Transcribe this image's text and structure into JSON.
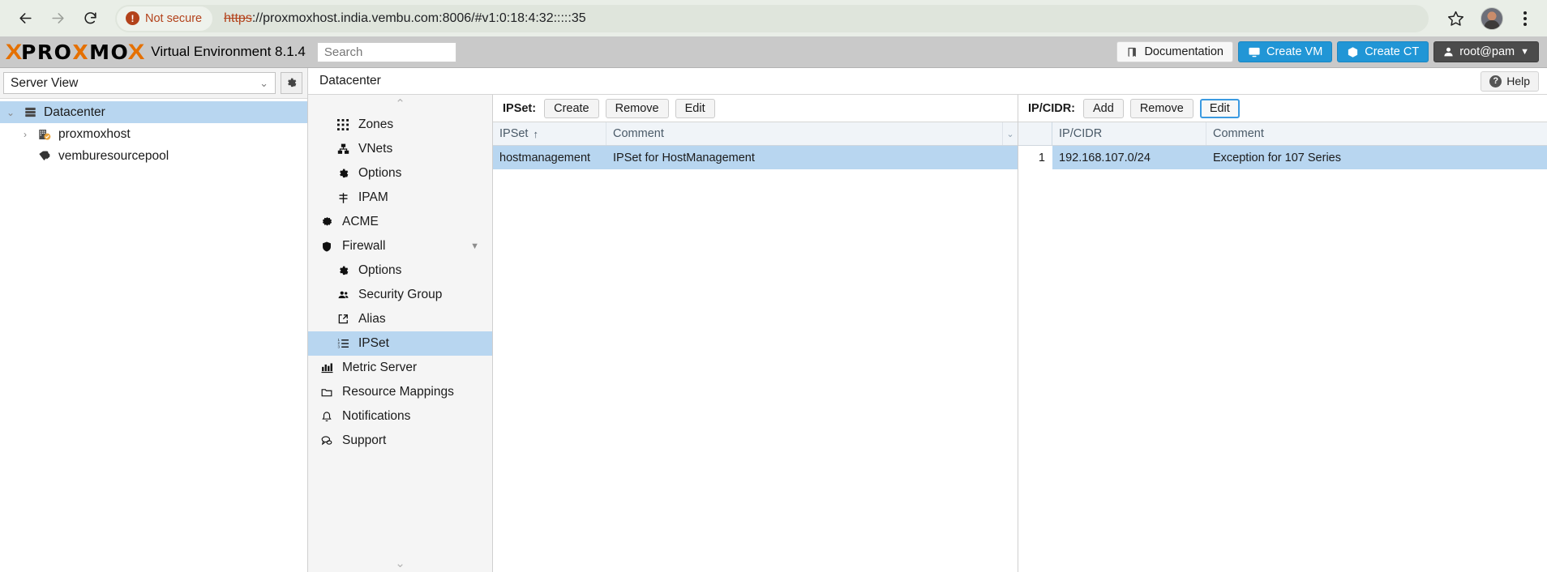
{
  "browser": {
    "back_icon": "back-arrow",
    "forward_icon": "forward-arrow",
    "reload_icon": "reload",
    "security_label": "Not secure",
    "url_scheme": "https",
    "url_rest": "://proxmoxhost.india.vembu.com:8006/#v1:0:18:4:32:::::35",
    "star_icon": "bookmark-star",
    "menu_icon": "three-dot-menu"
  },
  "header": {
    "logo_prefix": "PRO",
    "logo_x1": "X",
    "logo_mid": "MO",
    "logo_x2": "X",
    "product_title": "Virtual Environment 8.1.4",
    "search_placeholder": "Search",
    "search_value": "",
    "documentation_label": "Documentation",
    "create_vm_label": "Create VM",
    "create_ct_label": "Create CT",
    "user_label": "root@pam",
    "accent_blue": "#2196d6",
    "accent_orange": "#e57000"
  },
  "sidebar": {
    "view_selector_value": "Server View",
    "gear_icon": "gear-icon",
    "tree": [
      {
        "label": "Datacenter",
        "icon": "datacenter-icon",
        "selected": true,
        "twisty": "expanded",
        "level": 0
      },
      {
        "label": "proxmoxhost",
        "icon": "node-icon",
        "selected": false,
        "twisty": "collapsed",
        "level": 1
      },
      {
        "label": "vemburesourcepool",
        "icon": "pool-tag-icon",
        "selected": false,
        "twisty": "none",
        "level": 1
      }
    ]
  },
  "breadcrumb": {
    "title": "Datacenter",
    "help_label": "Help",
    "help_icon": "question-circle-icon"
  },
  "nav": {
    "scroll_up_icon": "chevron-up-icon",
    "scroll_down_icon": "chevron-down-icon",
    "items": [
      {
        "label": "Zones",
        "icon": "grid-icon",
        "level": 1,
        "selected": false
      },
      {
        "label": "VNets",
        "icon": "sitemap-icon",
        "level": 1,
        "selected": false
      },
      {
        "label": "Options",
        "icon": "gear-icon",
        "level": 1,
        "selected": false
      },
      {
        "label": "IPAM",
        "icon": "signpost-icon",
        "level": 1,
        "selected": false
      },
      {
        "label": "ACME",
        "icon": "certificate-icon",
        "level": 0,
        "selected": false
      },
      {
        "label": "Firewall",
        "icon": "shield-icon",
        "level": 0,
        "selected": false,
        "caret": true
      },
      {
        "label": "Options",
        "icon": "gear-icon",
        "level": 1,
        "selected": false
      },
      {
        "label": "Security Group",
        "icon": "users-icon",
        "level": 1,
        "selected": false
      },
      {
        "label": "Alias",
        "icon": "external-link-icon",
        "level": 1,
        "selected": false
      },
      {
        "label": "IPSet",
        "icon": "list-ol-icon",
        "level": 1,
        "selected": true
      },
      {
        "label": "Metric Server",
        "icon": "bar-chart-icon",
        "level": 0,
        "selected": false
      },
      {
        "label": "Resource Mappings",
        "icon": "folder-icon",
        "level": 0,
        "selected": false
      },
      {
        "label": "Notifications",
        "icon": "bell-icon",
        "level": 0,
        "selected": false
      },
      {
        "label": "Support",
        "icon": "comments-icon",
        "level": 0,
        "selected": false
      }
    ]
  },
  "ipset_panel": {
    "toolbar_label": "IPSet:",
    "buttons": [
      {
        "label": "Create",
        "focused": false
      },
      {
        "label": "Remove",
        "focused": false
      },
      {
        "label": "Edit",
        "focused": false
      }
    ],
    "columns": [
      {
        "label": "IPSet",
        "sort": "↑"
      },
      {
        "label": "Comment",
        "sort": ""
      }
    ],
    "column_menu_icon": "chevron-down-icon",
    "rows": [
      {
        "ipset": "hostmanagement",
        "comment": "IPSet for HostManagement",
        "selected": true
      }
    ]
  },
  "ipcidr_panel": {
    "toolbar_label": "IP/CIDR:",
    "buttons": [
      {
        "label": "Add",
        "focused": false
      },
      {
        "label": "Remove",
        "focused": false
      },
      {
        "label": "Edit",
        "focused": true
      }
    ],
    "columns": [
      {
        "label": "",
        "sort": ""
      },
      {
        "label": "IP/CIDR",
        "sort": ""
      },
      {
        "label": "Comment",
        "sort": ""
      }
    ],
    "rows": [
      {
        "num": "1",
        "ipcidr": "192.168.107.0/24",
        "comment": "Exception for 107 Series",
        "selected": true
      }
    ]
  }
}
